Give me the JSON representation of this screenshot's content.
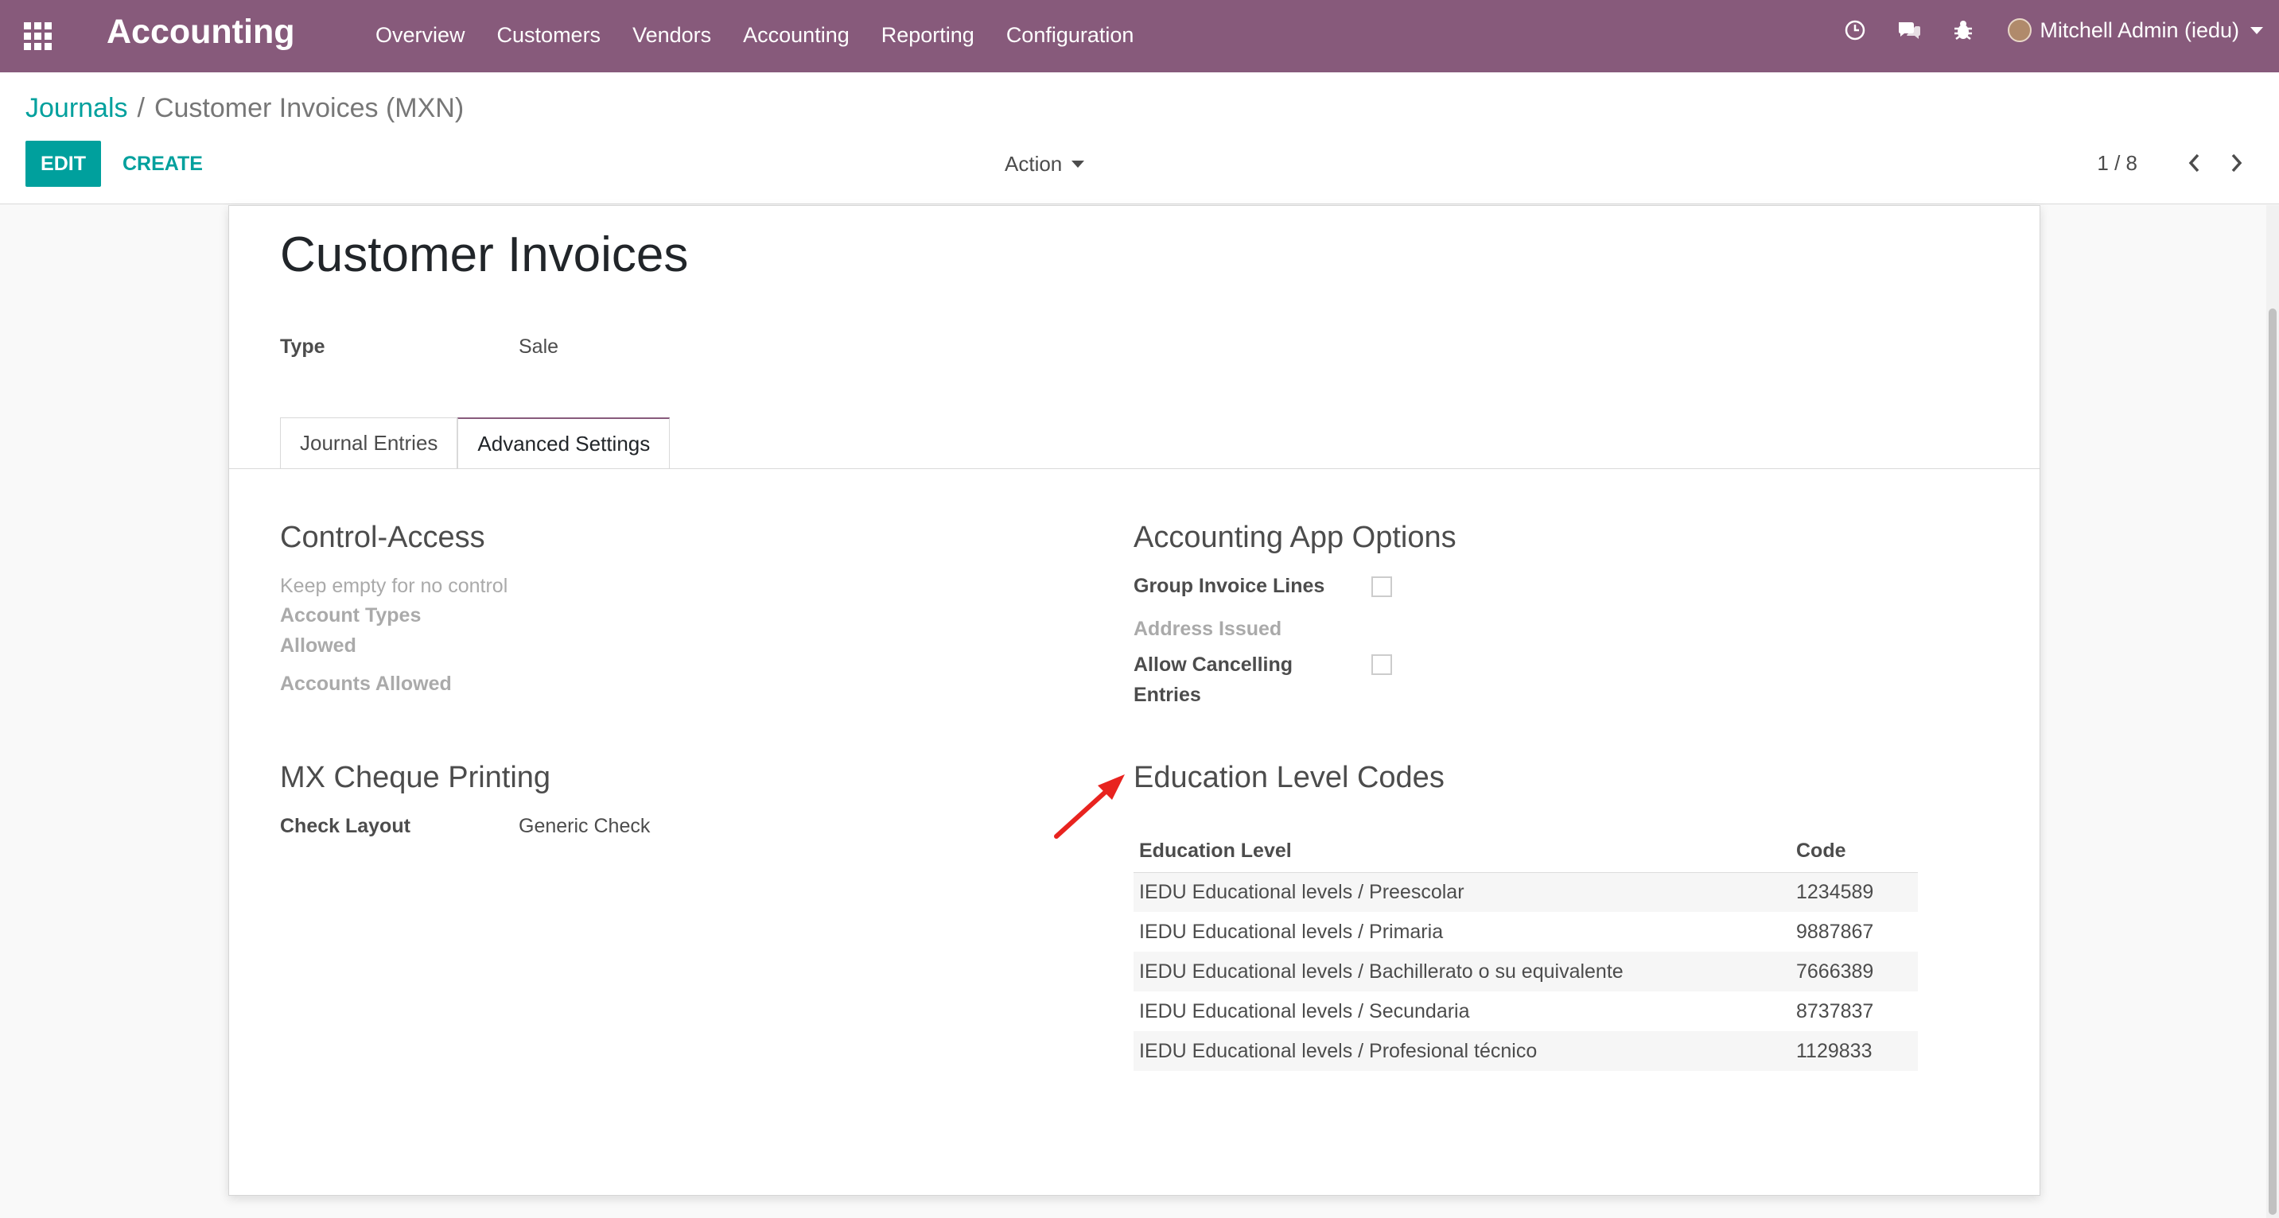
{
  "navbar": {
    "brand": "Accounting",
    "menu": [
      "Overview",
      "Customers",
      "Vendors",
      "Accounting",
      "Reporting",
      "Configuration"
    ],
    "user": "Mitchell Admin (iedu)",
    "color": "#875a7b"
  },
  "control_panel": {
    "breadcrumb_parent": "Journals",
    "breadcrumb_separator": "/",
    "breadcrumb_current": "Customer Invoices (MXN)",
    "edit_label": "EDIT",
    "create_label": "CREATE",
    "action_label": "Action",
    "pager": "1 / 8",
    "accent": "#00a09d"
  },
  "form": {
    "title": "Customer Invoices",
    "type_label": "Type",
    "type_value": "Sale",
    "tabs": [
      "Journal Entries",
      "Advanced Settings"
    ],
    "active_tab": "Advanced Settings",
    "control_access": {
      "title": "Control-Access",
      "help": "Keep empty for no control",
      "account_types_label_1": "Account Types",
      "account_types_label_2": "Allowed",
      "accounts_allowed_label": "Accounts Allowed"
    },
    "mx_cheque": {
      "title": "MX Cheque Printing",
      "check_layout_label": "Check Layout",
      "check_layout_value": "Generic Check"
    },
    "accounting_options": {
      "title": "Accounting App Options",
      "group_invoice_lines_label": "Group Invoice Lines",
      "group_invoice_lines_checked": false,
      "address_issued_label": "Address Issued",
      "allow_cancelling_label_1": "Allow Cancelling",
      "allow_cancelling_label_2": "Entries",
      "allow_cancelling_checked": false
    },
    "education_codes": {
      "title": "Education Level Codes",
      "headers": {
        "level": "Education Level",
        "code": "Code"
      },
      "rows": [
        {
          "level": "IEDU Educational levels / Preescolar",
          "code": "1234589"
        },
        {
          "level": "IEDU Educational levels / Primaria",
          "code": "9887867"
        },
        {
          "level": "IEDU Educational levels / Bachillerato o su equivalente",
          "code": "7666389"
        },
        {
          "level": "IEDU Educational levels / Secundaria",
          "code": "8737837"
        },
        {
          "level": "IEDU Educational levels / Profesional técnico",
          "code": "1129833"
        }
      ]
    }
  },
  "annotation": {
    "icon": "red-arrow-icon",
    "color": "#e8231f"
  }
}
